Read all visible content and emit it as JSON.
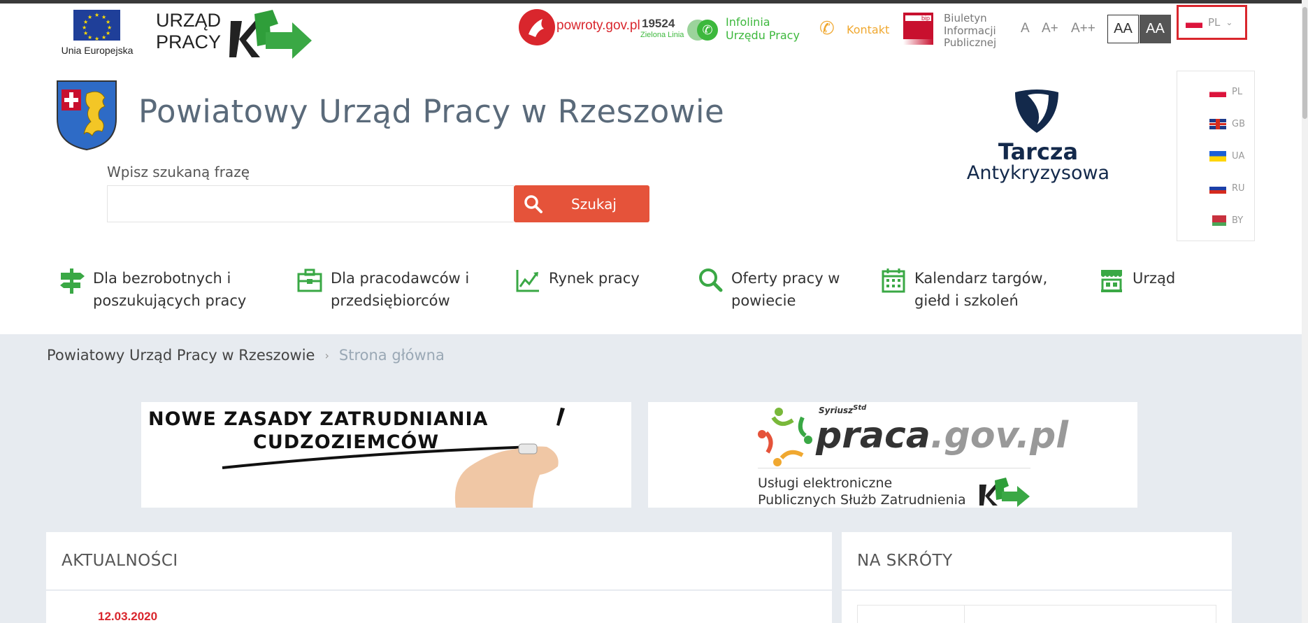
{
  "top": {
    "eu_label": "Unia Europejska",
    "up_logo_line1": "URZĄD",
    "up_logo_line2": "PRACY",
    "powroty": "powroty.gov.pl",
    "infolinia_number": "19524",
    "infolinia_sub": "Zielona Linia",
    "infolinia_line1": "Infolinia",
    "infolinia_line2": "Urzędu Pracy",
    "kontakt": "Kontakt",
    "bip_tag": "bip",
    "bip_line1": "Biuletyn",
    "bip_line2": "Informacji",
    "bip_line3": "Publicznej",
    "font_sizes": [
      "A",
      "A+",
      "A++"
    ],
    "contrast": [
      "AA",
      "AA"
    ],
    "language": "PL"
  },
  "languages": [
    "PL",
    "GB",
    "UA",
    "RU",
    "BY"
  ],
  "site": {
    "title": "Powiatowy Urząd Pracy w Rzeszowie",
    "search_label": "Wpisz szukaną frazę",
    "search_value": "",
    "search_button": "Szukaj",
    "tarcza_line1": "Tarcza",
    "tarcza_line2": "Antykryzysowa"
  },
  "nav": [
    {
      "line1": "Dla bezrobotnych i",
      "line2": "poszukujących pracy",
      "icon": "signpost-icon"
    },
    {
      "line1": "Dla pracodawców i",
      "line2": "przedsiębiorców",
      "icon": "briefcase-icon"
    },
    {
      "line1": "Rynek pracy",
      "line2": "",
      "icon": "chart-icon"
    },
    {
      "line1": "Oferty pracy w",
      "line2": "powiecie",
      "icon": "search-icon"
    },
    {
      "line1": "Kalendarz targów,",
      "line2": "giełd i szkoleń",
      "icon": "calendar-icon"
    },
    {
      "line1": "Urząd",
      "line2": "",
      "icon": "building-icon"
    }
  ],
  "breadcrumb": {
    "home": "Powiatowy Urząd Pracy w Rzeszowie",
    "separator": "›",
    "current": "Strona główna"
  },
  "banners": {
    "b1_line1": "NOWE ZASADY ZATRUDNIANIA",
    "b1_line2": "CUDZOZIEMCÓW",
    "b2_syriusz": "Syriusz",
    "b2_std": "Std",
    "b2_praca": "praca",
    "b2_gov": ".gov.pl",
    "b2_sub1": "Usługi elektroniczne",
    "b2_sub2": "Publicznych Służb Zatrudnienia"
  },
  "panels": {
    "news_title": "AKTUALNOŚCI",
    "news_date": "12.03.2020",
    "short_title": "NA SKRÓTY"
  },
  "colors": {
    "accent_green": "#3db83d",
    "search_button": "#e5533a",
    "highlight_red": "#d9262d",
    "tarcza_navy": "#13294b"
  }
}
